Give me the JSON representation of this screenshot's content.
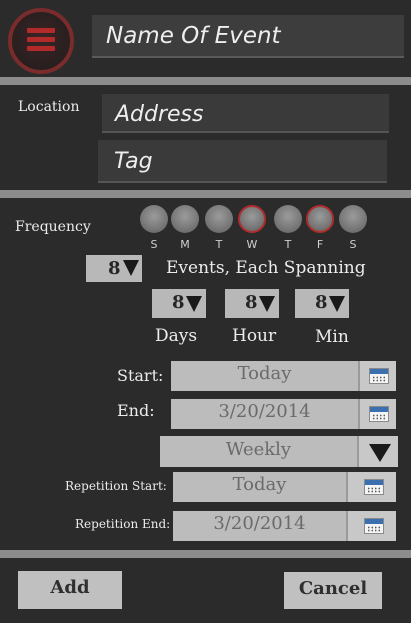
{
  "header": {
    "event_name_placeholder": "Name Of Event"
  },
  "location": {
    "label": "Location",
    "address_placeholder": "Address",
    "tag_placeholder": "Tag"
  },
  "frequency": {
    "label": "Frequency",
    "days": [
      {
        "letter": "S",
        "selected": false
      },
      {
        "letter": "M",
        "selected": false
      },
      {
        "letter": "T",
        "selected": false
      },
      {
        "letter": "W",
        "selected": true
      },
      {
        "letter": "T",
        "selected": false
      },
      {
        "letter": "F",
        "selected": true
      },
      {
        "letter": "S",
        "selected": false
      }
    ],
    "events_count": "8",
    "events_text": "Events, Each Spanning",
    "span": {
      "days": {
        "value": "8",
        "label": "Days"
      },
      "hour": {
        "value": "8",
        "label": "Hour"
      },
      "min": {
        "value": "8",
        "label": "Min"
      }
    }
  },
  "schedule": {
    "start_label": "Start:",
    "start_value": "Today",
    "end_label": "End:",
    "end_value": "3/20/2014",
    "repeat_value": "Weekly",
    "rep_start_label": "Repetition Start:",
    "rep_start_value": "Today",
    "rep_end_label": "Repetition End:",
    "rep_end_value": "3/20/2014"
  },
  "actions": {
    "add": "Add",
    "cancel": "Cancel"
  },
  "colors": {
    "background": "#2b2b2b",
    "accent_red": "#b22a2a",
    "divider": "#8c8c8c"
  }
}
